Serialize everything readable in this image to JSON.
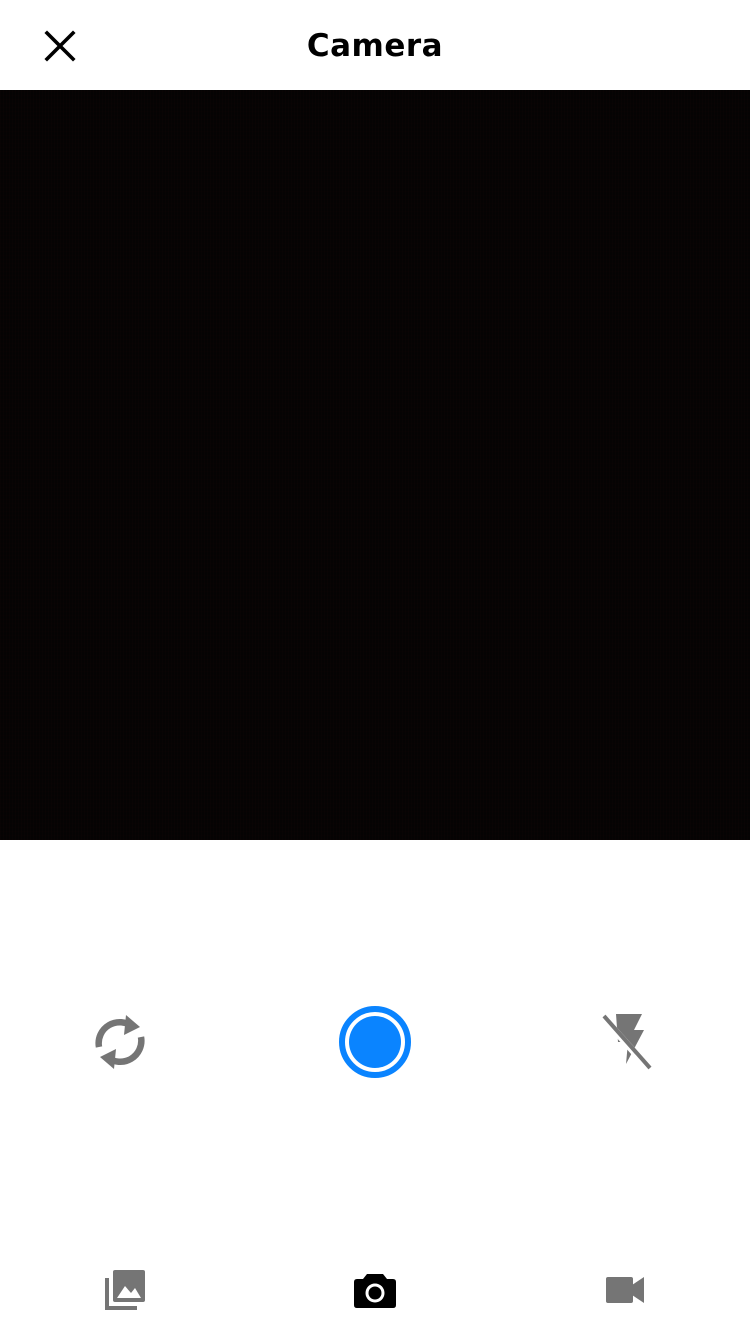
{
  "header": {
    "title": "Camera",
    "close_icon": "close-icon"
  },
  "viewfinder": {
    "state": "dark"
  },
  "controls": {
    "flip_icon": "flip-camera-icon",
    "shutter_icon": "shutter-icon",
    "flash_icon": "flash-off-icon"
  },
  "bottom_tabs": [
    {
      "icon": "gallery-icon",
      "active": false
    },
    {
      "icon": "camera-icon",
      "active": true
    },
    {
      "icon": "video-icon",
      "active": false
    }
  ],
  "colors": {
    "accent": "#0A84FF",
    "icon_inactive": "#757575",
    "icon_active": "#000000",
    "viewfinder_bg": "#050303"
  }
}
